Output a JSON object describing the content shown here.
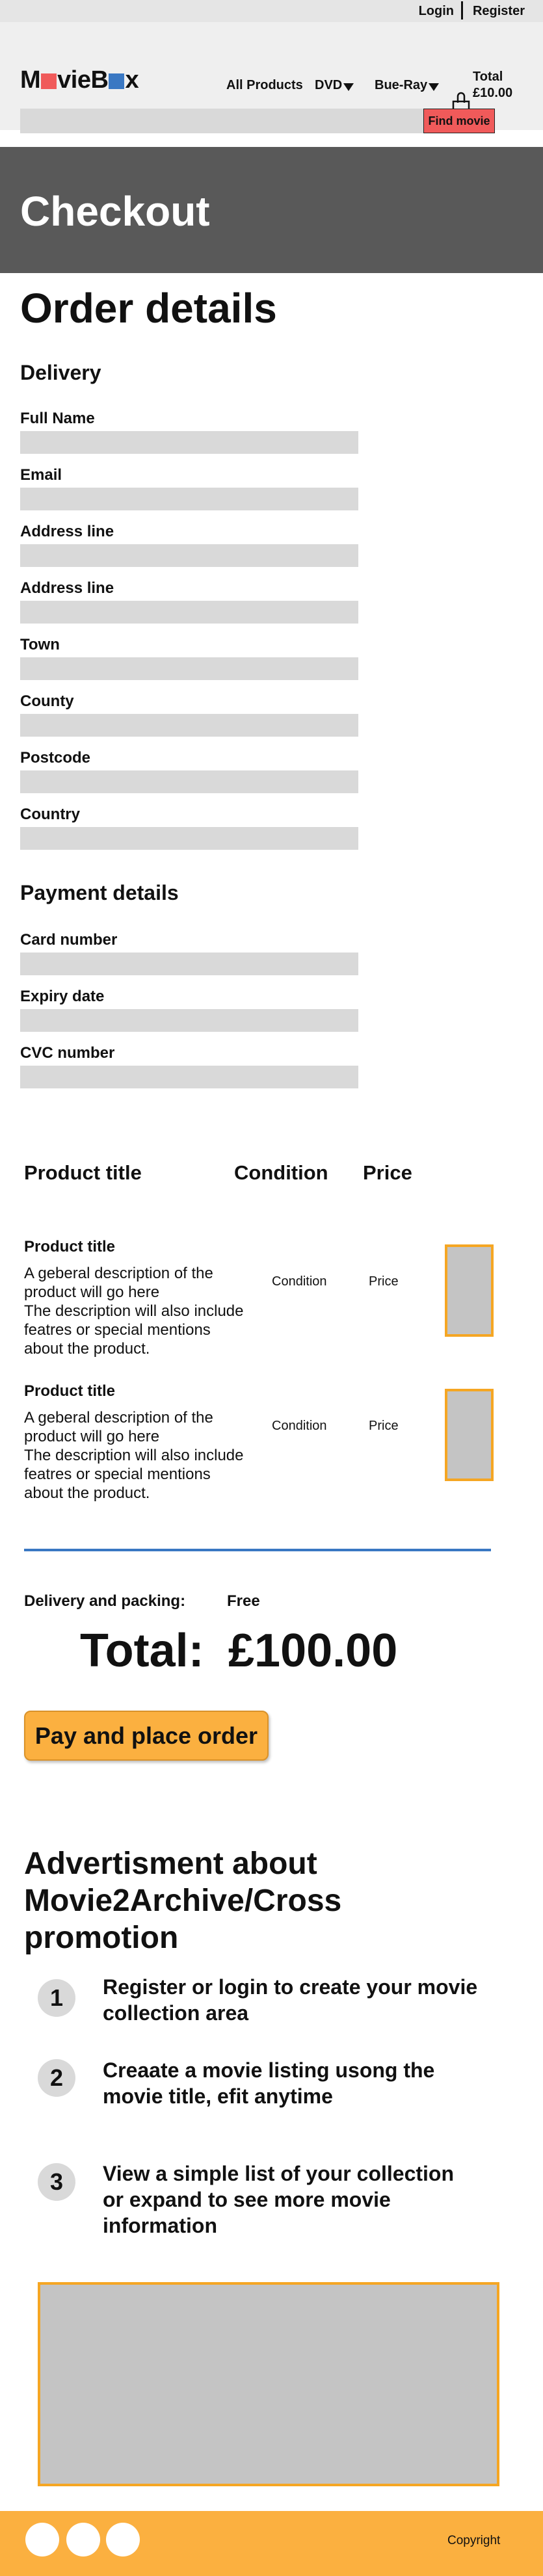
{
  "topbar": {
    "login": "Login",
    "register": "Register"
  },
  "header": {
    "logo": {
      "part1": "M",
      "part2": "vieB",
      "part3": "x"
    },
    "nav": {
      "all_products": "All Products",
      "dvd": "DVD",
      "bluray": "Bue-Ray"
    },
    "basket": {
      "label": "Total",
      "value": "£10.00"
    }
  },
  "search": {
    "placeholder": "",
    "button": "Find movie"
  },
  "banner": {
    "title": "Checkout"
  },
  "order": {
    "title": "Order details",
    "delivery_title": "Delivery",
    "delivery_fields": [
      "Full Name",
      "Email",
      "Address line",
      "Address line",
      "Town",
      "County",
      "Postcode",
      "Country"
    ],
    "payment_title": "Payment details",
    "payment_fields": [
      "Card number",
      "Expiry date",
      "CVC number"
    ]
  },
  "table": {
    "headers": {
      "title": "Product title",
      "condition": "Condition",
      "price": "Price"
    },
    "rows": [
      {
        "title": "Product title",
        "description": "A geberal description of the product will go here\nThe description will also include featres or special mentions about the product.",
        "condition": "Condition",
        "price": "Price"
      },
      {
        "title": "Product title",
        "description": "A geberal description of the product will go here\nThe description will also include featres or special mentions about the product.",
        "condition": "Condition",
        "price": "Price"
      }
    ]
  },
  "summary": {
    "delivery_label": "Delivery and packing:",
    "delivery_value": "Free",
    "total_label": "Total:",
    "total_value": "£100.00",
    "pay_button": "Pay and place order"
  },
  "advert": {
    "title": "Advertisment about Movie2Archive/Cross promotion",
    "steps": [
      {
        "number": "1",
        "text": "Register or login to create your movie collection area"
      },
      {
        "number": "2",
        "text": "Creaate a movie listing usong the movie title, efit anytime"
      },
      {
        "number": "3",
        "text": "View a simple list of your collection or expand to see more movie information"
      }
    ]
  },
  "footer": {
    "copyright": "Copyright"
  },
  "colors": {
    "accent": "#fbb040",
    "find_button": "#f05a5a",
    "banner": "#595959",
    "divider": "#3a78c3",
    "logo_box_1": "#f05a5a",
    "logo_box_2": "#3a78c3"
  }
}
